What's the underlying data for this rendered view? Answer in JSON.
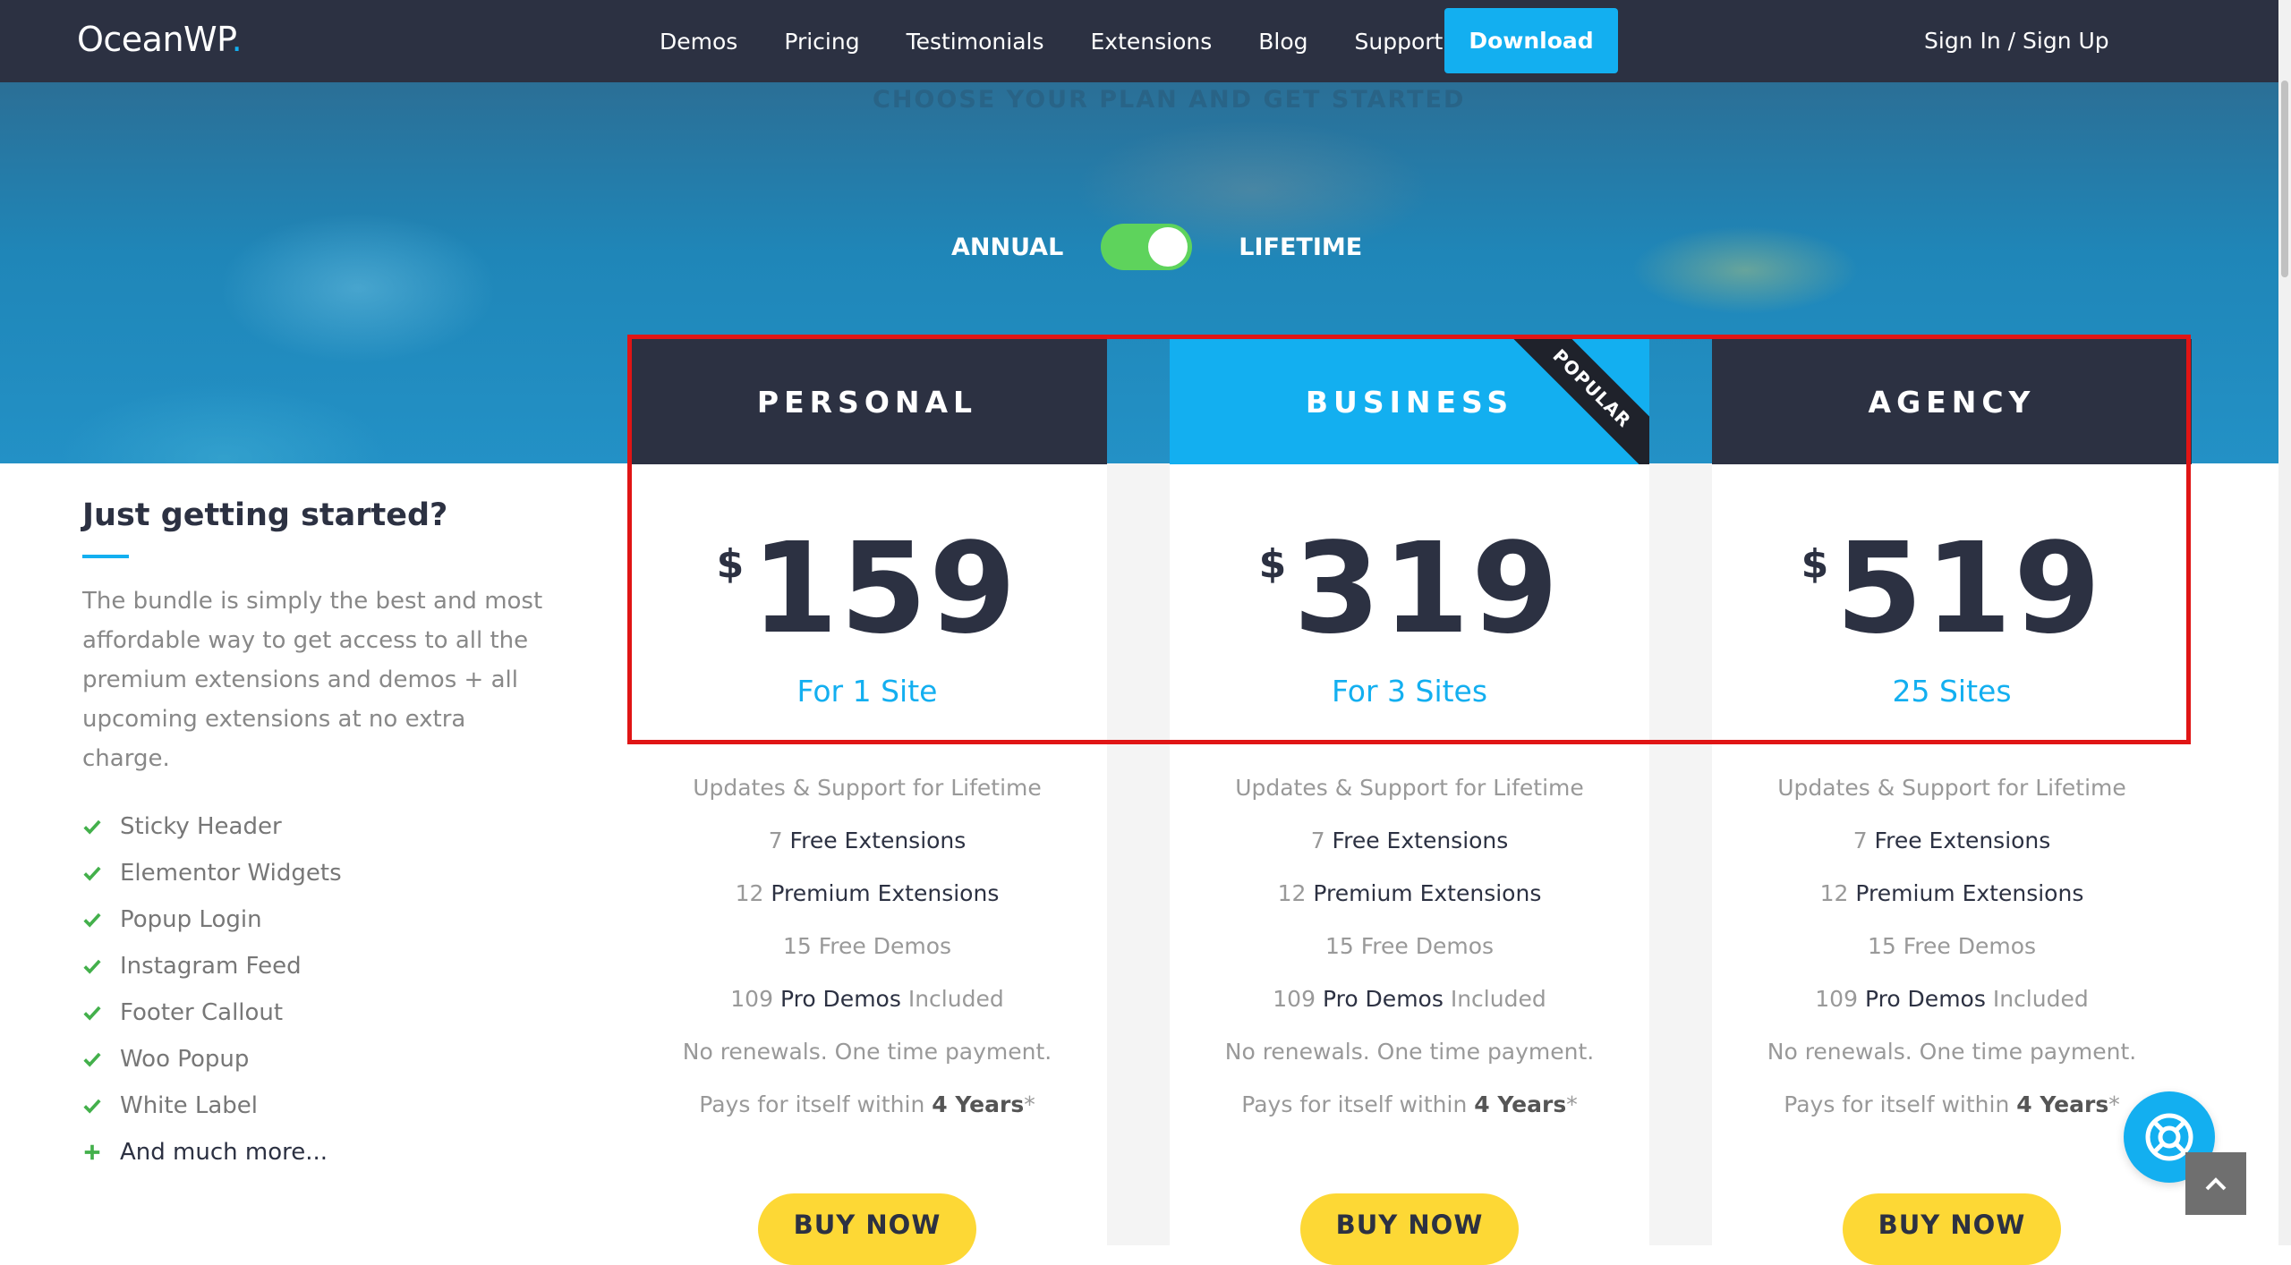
{
  "header": {
    "logo_text": "OceanWP",
    "logo_dot": ".",
    "nav": [
      "Demos",
      "Pricing",
      "Testimonials",
      "Extensions",
      "Blog",
      "Support"
    ],
    "download_label": "Download",
    "signin_label": "Sign In / Sign Up"
  },
  "hero": {
    "faded_heading": "CHOOSE YOUR PLAN AND GET STARTED",
    "toggle_left": "ANNUAL",
    "toggle_right": "LIFETIME",
    "toggle_state": "lifetime"
  },
  "left": {
    "title": "Just getting started?",
    "description": "The bundle is simply the best and most affordable way to get access to all the premium extensions and demos + all upcoming extensions at no extra charge.",
    "features": [
      "Sticky Header",
      "Elementor Widgets",
      "Popup Login",
      "Instagram Feed",
      "Footer Callout",
      "Woo Popup",
      "White Label"
    ],
    "more": "And much more..."
  },
  "plans": [
    {
      "name": "PERSONAL",
      "currency": "$",
      "price": "159",
      "sites": "For 1 Site",
      "f1": "Updates & Support for Lifetime",
      "f2_num": "7",
      "f2_text": "Free Extensions",
      "f3_num": "12",
      "f3_text": "Premium Extensions",
      "f4": "15 Free Demos",
      "f5_num": "109",
      "f5_text": "Pro Demos",
      "f5_suffix": "Included",
      "f6": "No renewals. One time payment.",
      "f7_text": "Pays for itself within",
      "f7_bold": "4 Years",
      "f7_suffix": "*",
      "buy": "BUY NOW"
    },
    {
      "name": "BUSINESS",
      "currency": "$",
      "price": "319",
      "sites": "For 3 Sites",
      "ribbon": "POPULAR",
      "f1": "Updates & Support for Lifetime",
      "f2_num": "7",
      "f2_text": "Free Extensions",
      "f3_num": "12",
      "f3_text": "Premium Extensions",
      "f4": "15 Free Demos",
      "f5_num": "109",
      "f5_text": "Pro Demos",
      "f5_suffix": "Included",
      "f6": "No renewals. One time payment.",
      "f7_text": "Pays for itself within",
      "f7_bold": "4 Years",
      "f7_suffix": "*",
      "buy": "BUY NOW"
    },
    {
      "name": "AGENCY",
      "currency": "$",
      "price": "519",
      "sites": "25 Sites",
      "f1": "Updates & Support for Lifetime",
      "f2_num": "7",
      "f2_text": "Free Extensions",
      "f3_num": "12",
      "f3_text": "Premium Extensions",
      "f4": "15 Free Demos",
      "f5_num": "109",
      "f5_text": "Pro Demos",
      "f5_suffix": "Included",
      "f6": "No renewals. One time payment.",
      "f7_text": "Pays for itself within",
      "f7_bold": "4 Years",
      "f7_suffix": "*",
      "buy": "BUY NOW"
    }
  ],
  "colors": {
    "nav_bg": "#2c3142",
    "accent": "#13aff0",
    "toggle_on": "#5ed35c",
    "buy_button": "#fdd835",
    "highlight_border": "#e01515"
  },
  "icons": {
    "help": "lifebuoy-icon",
    "scroll_top": "chevron-up-icon",
    "feature_check": "check-icon",
    "feature_more": "plus-icon"
  }
}
